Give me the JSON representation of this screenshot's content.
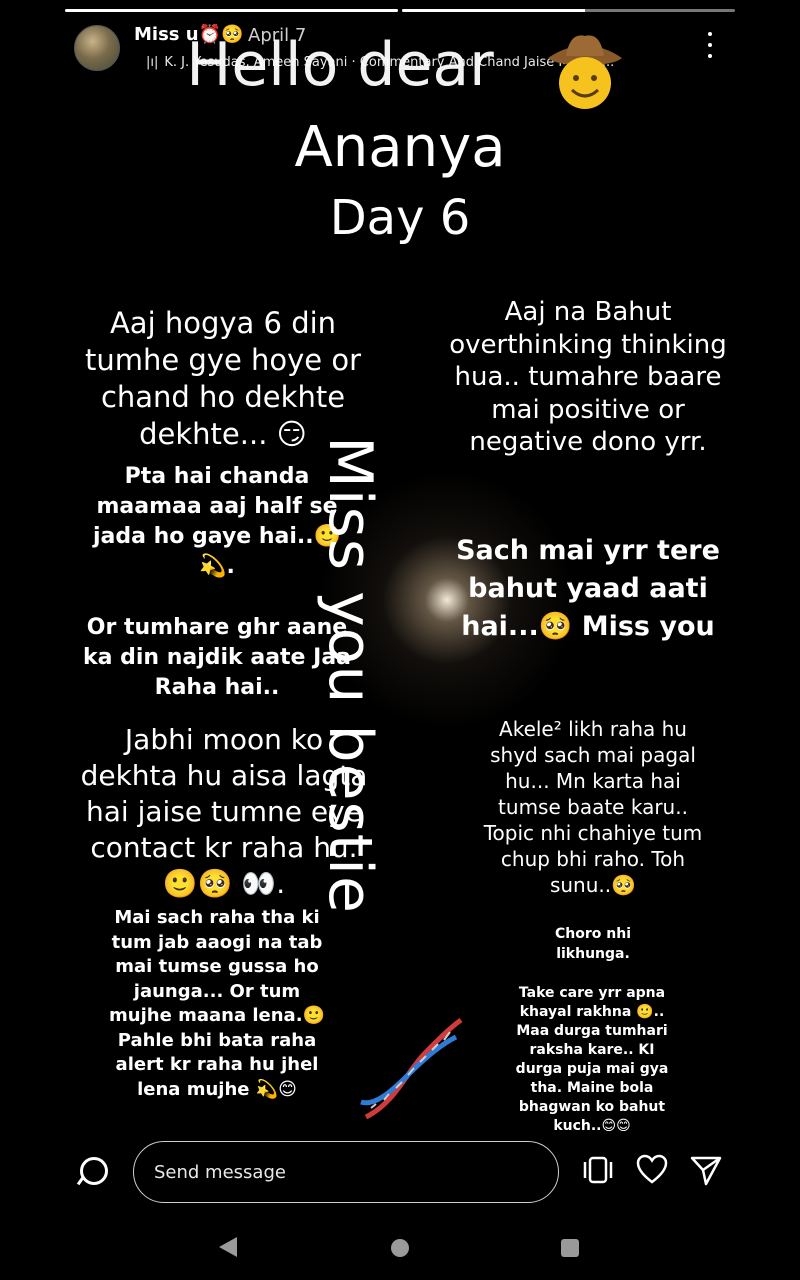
{
  "story": {
    "progress": {
      "segments_total": 2,
      "current_segment_fraction": 0.55
    },
    "username": "Miss u⏰🥺",
    "date": "April 7",
    "music": "K. J. Yesudas, Ameen Sayani · Commentary And Chand Jaise Mukhd...",
    "more_label": "more options",
    "heading": {
      "line1": "Hello dear",
      "line2": "Ananya",
      "line3": "Day 6"
    },
    "vertical_text": "Miss you bestie",
    "left": {
      "p1": "Aaj hogya 6 din tumhe gye hoye or chand ho dekhte dekhte... 😏",
      "p2": "Pta hai chanda maamaa aaj half se jada ho gaye hai..🙂💫.",
      "p3": "Or tumhare ghr aane ka din najdik aate Jaa Raha hai..",
      "p4": "Jabhi moon ko dekhta hu aisa lagta hai jaise tumne eye contact kr raha hu.🙂🥺 👀.",
      "p5": "Mai sach raha tha ki tum jab aaogi na tab mai tumse gussa ho jaunga... Or tum mujhe maana lena.🙂 Pahle bhi bata raha alert kr raha hu jhel lena mujhe 💫😊"
    },
    "right": {
      "p1": "Aaj na Bahut overthinking thinking hua.. tumahre baare mai positive or negative dono yrr.",
      "p2": "Sach mai yrr tere bahut yaad aati hai...🥺 Miss you",
      "p3": "Akele² likh raha hu shyd sach mai pagal hu... Mn karta hai tumse baate karu.. Topic nhi chahiye tum chup bhi raho. Toh sunu..🥺",
      "p4": "Choro nhi likhunga.",
      "p5": "Take care yrr apna khayal rakhna 🙂.. Maa durga tumhari raksha kare.. KI durga puja mai gya tha. Maine bola bhagwan ko bahut kuch..😊😊"
    }
  },
  "footer": {
    "message_placeholder": "Send message"
  },
  "colors": {
    "background": "#000000",
    "text": "#ffffff",
    "nav_icon": "#9a9a9a"
  }
}
